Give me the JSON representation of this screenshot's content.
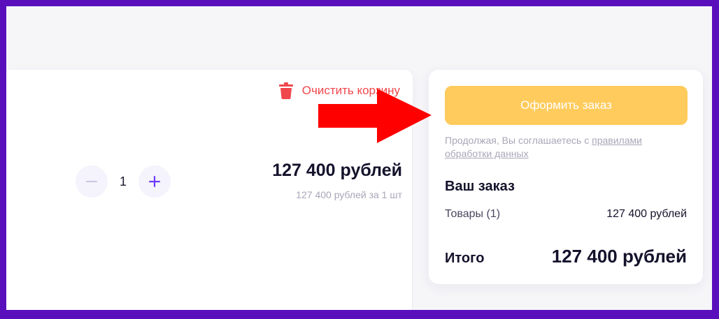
{
  "cart": {
    "clear_label": "Очистить корзину",
    "item": {
      "quantity": "1",
      "price": "127 400 рублей",
      "unit_price": "127 400 рублей за 1 шт"
    }
  },
  "summary": {
    "checkout_label": "Оформить заказ",
    "agreement_text": "Продолжая, Вы соглашаетесь с ",
    "agreement_link": "правилами обработки данных",
    "order_title": "Ваш заказ",
    "goods_label": "Товары (1)",
    "goods_value": "127 400 рублей",
    "total_label": "Итого",
    "total_value": "127 400 рублей"
  },
  "icons": {
    "trash": "trash-icon",
    "minus": "minus-icon",
    "plus": "plus-icon",
    "annotation": "red-arrow-icon"
  },
  "colors": {
    "border": "#5a0fbd",
    "background": "#f6f6f9",
    "accent_yellow": "#ffcb5c",
    "danger_red": "#f0474c",
    "plus_violet": "#6c3cff",
    "arrow_red": "#ff0000"
  }
}
